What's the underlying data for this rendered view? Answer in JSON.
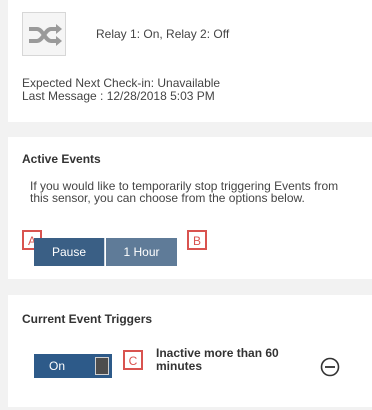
{
  "sensor": {
    "relay_status": "Relay 1: On, Relay 2: Off",
    "checkin": "Expected Next Check-in: Unavailable",
    "last_message": "Last Message : 12/28/2018 5:03 PM",
    "icon": "shuffle-icon"
  },
  "active_events": {
    "title": "Active Events",
    "description": "If you would like to temporarily stop triggering Events from this sensor, you can choose from the options below.",
    "pause_label": "Pause",
    "duration_label": "1 Hour",
    "marker_a": "A",
    "marker_b": "B"
  },
  "triggers": {
    "title": "Current Event Triggers",
    "toggle_label": "On",
    "marker_c": "C",
    "trigger_text": "Inactive more than 60 minutes",
    "remove_icon": "minus-circle-icon"
  },
  "colors": {
    "primary_button": "#3a5f85",
    "secondary_button": "#5f7b98",
    "toggle": "#2d5a89",
    "marker": "#d9534f"
  }
}
